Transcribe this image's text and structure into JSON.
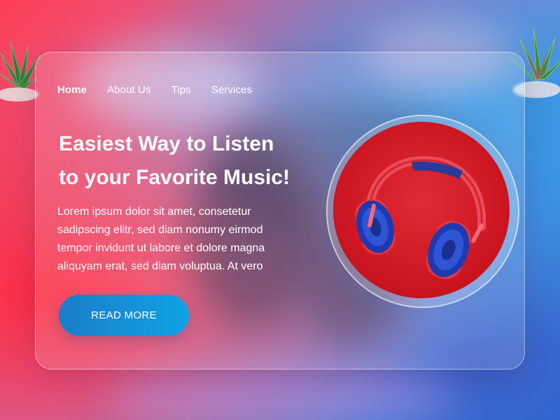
{
  "nav": {
    "items": [
      {
        "label": "Home",
        "active": true
      },
      {
        "label": "About Us",
        "active": false
      },
      {
        "label": "Tips",
        "active": false
      },
      {
        "label": "Services",
        "active": false
      }
    ]
  },
  "hero": {
    "headline_line1": "Easiest Way to Listen",
    "headline_line2": "to your Favorite Music!",
    "body_lines": [
      "Lorem ipsum dolor sit amet, consetetur",
      "sadipscing elitr, sed diam nonumy eirmod",
      "tempor invidunt ut labore et dolore magna",
      "aliquyam erat, sed diam voluptua. At vero"
    ],
    "button_label": "READ MORE"
  },
  "image": {
    "subject": "headphones-icon"
  },
  "colors": {
    "button": "#1a7ec9",
    "photo_background": "#d11a26",
    "headphone_cushion": "#2a45b8"
  }
}
